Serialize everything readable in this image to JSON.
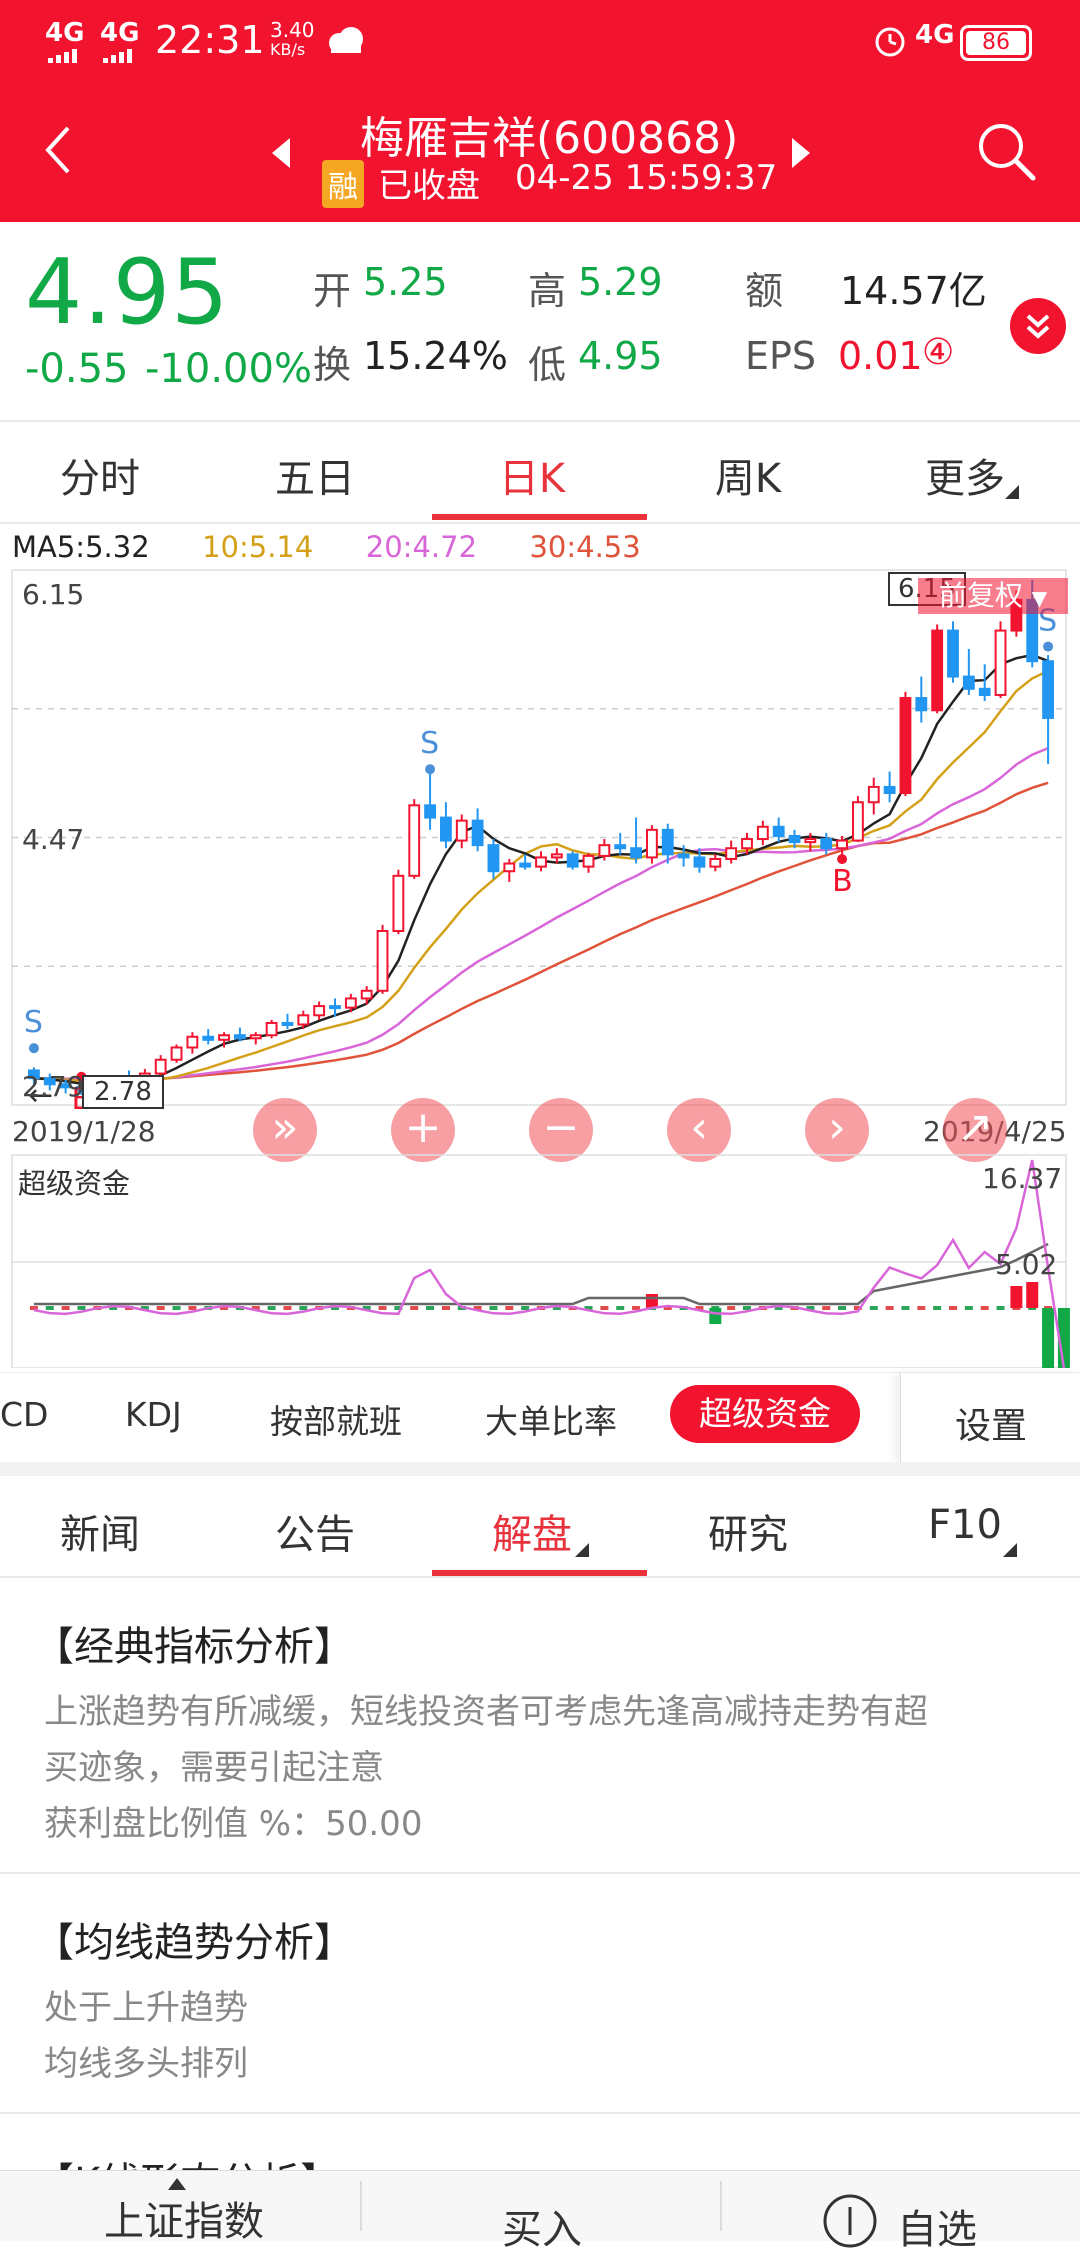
{
  "status": {
    "network1": "4G",
    "network2": "4G",
    "time": "22:31",
    "speed_value": "3.40",
    "speed_unit": "KB/s",
    "network3": "4G",
    "battery": "86"
  },
  "header": {
    "title": "梅雁吉祥(600868)",
    "badge": "融",
    "market_status": "已收盘",
    "datetime": "04-25 15:59:37"
  },
  "quote": {
    "price": "4.95",
    "change": "-0.55",
    "change_pct": "-10.00%",
    "open_label": "开",
    "open": "5.25",
    "high_label": "高",
    "high": "5.29",
    "amount_label": "额",
    "amount": "14.57亿",
    "turnover_label": "换",
    "turnover": "15.24%",
    "low_label": "低",
    "low": "4.95",
    "eps_label": "EPS",
    "eps": "0.01",
    "eps_badge": "④"
  },
  "chart_tabs": [
    {
      "label": "分时"
    },
    {
      "label": "五日"
    },
    {
      "label": "日K"
    },
    {
      "label": "周K"
    },
    {
      "label": "更多"
    }
  ],
  "colors": {
    "accent": "#f2132f",
    "up": "#f2132f",
    "down": "#2196f3",
    "ma5": "#222222",
    "ma10": "#d4a017",
    "ma20": "#d966d9",
    "ma30": "#e0533a"
  },
  "chart_data": [
    {
      "type": "candlestick",
      "ma_legend": [
        "MA5:5.32",
        "10:5.14",
        "20:4.72",
        "30:4.53"
      ],
      "ylim": [
        2.79,
        6.15
      ],
      "y_labels": [
        "6.15",
        "4.47",
        "2.79"
      ],
      "x_start": "2019/1/28",
      "x_end": "2019/4/25",
      "min_marker": "2.78",
      "max_marker": "6.15",
      "adjust_label": "前复权",
      "markers": [
        "S",
        "B",
        "S",
        "B",
        "S"
      ],
      "candles": [
        [
          2.95,
          2.97,
          2.85,
          2.9
        ],
        [
          2.9,
          2.93,
          2.82,
          2.86
        ],
        [
          2.86,
          2.89,
          2.8,
          2.84
        ],
        [
          2.84,
          2.86,
          2.79,
          2.82
        ],
        [
          2.82,
          2.88,
          2.8,
          2.86
        ],
        [
          2.86,
          2.92,
          2.84,
          2.9
        ],
        [
          2.9,
          2.95,
          2.86,
          2.88
        ],
        [
          2.88,
          2.96,
          2.85,
          2.93
        ],
        [
          2.93,
          3.05,
          2.92,
          3.02
        ],
        [
          3.02,
          3.12,
          3.0,
          3.1
        ],
        [
          3.1,
          3.2,
          3.06,
          3.17
        ],
        [
          3.17,
          3.22,
          3.12,
          3.15
        ],
        [
          3.15,
          3.2,
          3.1,
          3.18
        ],
        [
          3.18,
          3.23,
          3.14,
          3.16
        ],
        [
          3.16,
          3.2,
          3.12,
          3.18
        ],
        [
          3.18,
          3.28,
          3.16,
          3.26
        ],
        [
          3.26,
          3.32,
          3.22,
          3.25
        ],
        [
          3.25,
          3.34,
          3.22,
          3.31
        ],
        [
          3.31,
          3.4,
          3.28,
          3.37
        ],
        [
          3.37,
          3.42,
          3.3,
          3.36
        ],
        [
          3.36,
          3.45,
          3.33,
          3.42
        ],
        [
          3.42,
          3.5,
          3.38,
          3.47
        ],
        [
          3.47,
          3.9,
          3.45,
          3.86
        ],
        [
          3.86,
          4.26,
          3.84,
          4.22
        ],
        [
          4.22,
          4.72,
          4.2,
          4.68
        ],
        [
          4.68,
          4.92,
          4.52,
          4.6
        ],
        [
          4.6,
          4.7,
          4.4,
          4.45
        ],
        [
          4.45,
          4.62,
          4.4,
          4.58
        ],
        [
          4.58,
          4.66,
          4.38,
          4.42
        ],
        [
          4.42,
          4.46,
          4.2,
          4.25
        ],
        [
          4.25,
          4.33,
          4.18,
          4.3
        ],
        [
          4.3,
          4.36,
          4.26,
          4.28
        ],
        [
          4.28,
          4.38,
          4.25,
          4.34
        ],
        [
          4.34,
          4.4,
          4.3,
          4.36
        ],
        [
          4.36,
          4.38,
          4.26,
          4.28
        ],
        [
          4.28,
          4.37,
          4.24,
          4.35
        ],
        [
          4.35,
          4.46,
          4.32,
          4.42
        ],
        [
          4.42,
          4.5,
          4.36,
          4.4
        ],
        [
          4.4,
          4.6,
          4.3,
          4.34
        ],
        [
          4.34,
          4.55,
          4.3,
          4.52
        ],
        [
          4.52,
          4.56,
          4.3,
          4.36
        ],
        [
          4.36,
          4.42,
          4.28,
          4.34
        ],
        [
          4.34,
          4.4,
          4.24,
          4.28
        ],
        [
          4.28,
          4.36,
          4.25,
          4.33
        ],
        [
          4.33,
          4.45,
          4.3,
          4.4
        ],
        [
          4.4,
          4.5,
          4.36,
          4.46
        ],
        [
          4.46,
          4.58,
          4.42,
          4.54
        ],
        [
          4.54,
          4.6,
          4.44,
          4.48
        ],
        [
          4.48,
          4.52,
          4.4,
          4.44
        ],
        [
          4.44,
          4.5,
          4.38,
          4.46
        ],
        [
          4.46,
          4.5,
          4.36,
          4.4
        ],
        [
          4.4,
          4.48,
          4.36,
          4.45
        ],
        [
          4.45,
          4.74,
          4.44,
          4.7
        ],
        [
          4.7,
          4.86,
          4.62,
          4.8
        ],
        [
          4.8,
          4.9,
          4.7,
          4.76
        ],
        [
          4.76,
          5.42,
          4.74,
          5.38
        ],
        [
          5.38,
          5.52,
          5.22,
          5.3
        ],
        [
          5.3,
          5.86,
          5.28,
          5.82
        ],
        [
          5.82,
          5.88,
          5.48,
          5.52
        ],
        [
          5.52,
          5.7,
          5.4,
          5.44
        ],
        [
          5.44,
          5.6,
          5.36,
          5.4
        ],
        [
          5.4,
          5.88,
          5.38,
          5.82
        ],
        [
          5.82,
          6.08,
          5.78,
          6.02
        ],
        [
          6.02,
          6.15,
          5.58,
          5.62
        ],
        [
          5.62,
          5.66,
          4.95,
          5.25
        ]
      ]
    },
    {
      "type": "line",
      "title": "超级资金",
      "ylim": [
        0,
        16.37
      ],
      "y_labels": [
        "16.37",
        "5.02"
      ]
    }
  ],
  "chart_controls": [
    {
      "icon": "fast-forward-icon",
      "glyph": "»"
    },
    {
      "icon": "zoom-in-icon",
      "glyph": "+"
    },
    {
      "icon": "zoom-out-icon",
      "glyph": "−"
    },
    {
      "icon": "chevron-left-icon",
      "glyph": "‹"
    },
    {
      "icon": "chevron-right-icon",
      "glyph": "›"
    },
    {
      "icon": "expand-icon",
      "glyph": "↗"
    }
  ],
  "indicators": [
    "CD",
    "KDJ",
    "按部就班",
    "大单比率",
    "超级资金"
  ],
  "settings_label": "设置",
  "news_tabs": [
    {
      "label": "新闻"
    },
    {
      "label": "公告"
    },
    {
      "label": "解盘"
    },
    {
      "label": "研究"
    },
    {
      "label": "F10"
    }
  ],
  "analysis": {
    "classic_title": "【经典指标分析】",
    "classic_line1": "上涨趋势有所减缓，短线投资者可考虑先逢高减持走势有超",
    "classic_line2": "买迹象，需要引起注意",
    "classic_line3": "获利盘比例值 %：50.00",
    "ma_title": "【均线趋势分析】",
    "ma_line1": "处于上升趋势",
    "ma_line2": "均线多头排列",
    "kline_title": "【K线形态分析】"
  },
  "bottom_bar": {
    "index_label": "上证指数",
    "buy_label": "买入",
    "watch_label": "自选"
  }
}
